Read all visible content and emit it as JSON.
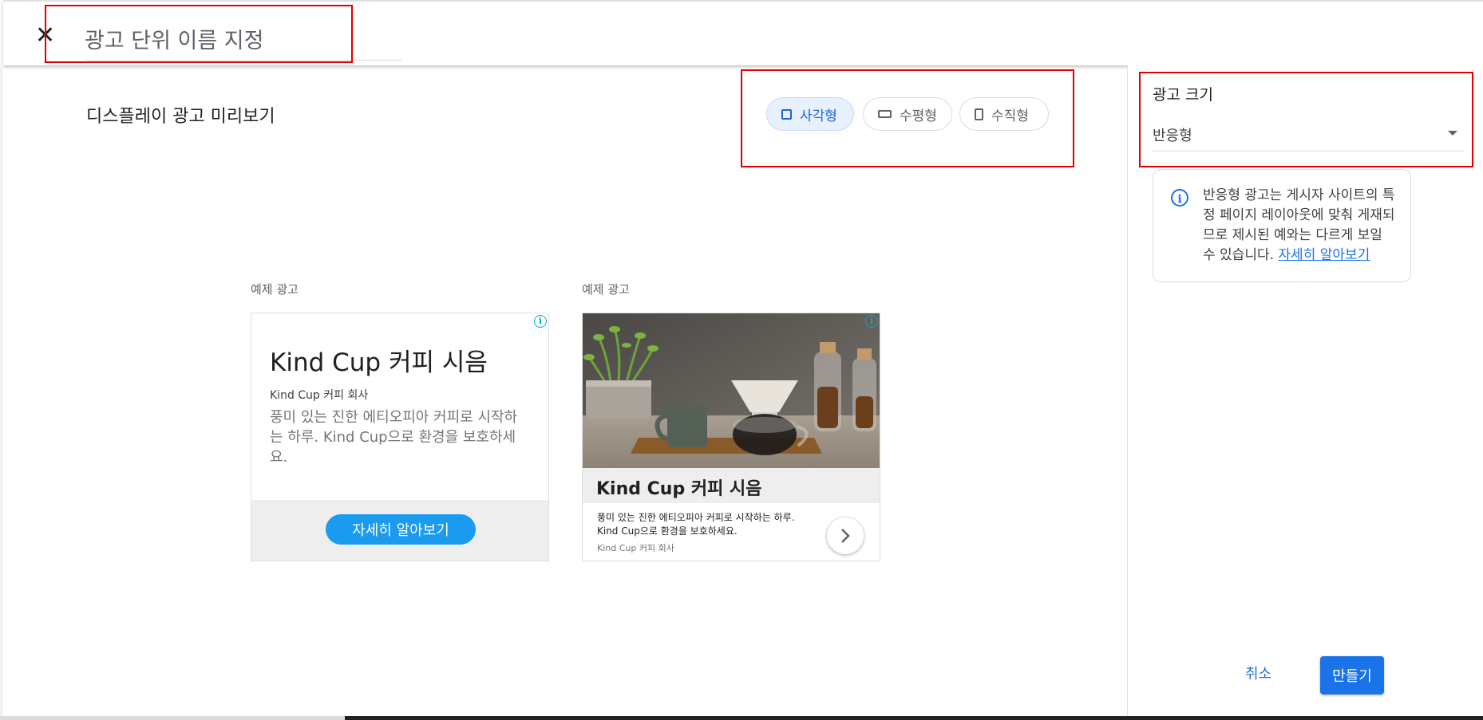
{
  "header": {
    "close_icon": "close-icon",
    "name_placeholder": "광고 단위 이름 지정"
  },
  "preview": {
    "title": "디스플레이 광고 미리보기",
    "shapes": [
      {
        "label": "사각형",
        "icon": "square-icon",
        "selected": true
      },
      {
        "label": "수평형",
        "icon": "horizontal-rect-icon",
        "selected": false
      },
      {
        "label": "수직형",
        "icon": "vertical-rect-icon",
        "selected": false
      }
    ]
  },
  "sidebar": {
    "size_label": "광고 크기",
    "size_value": "반응형",
    "info_text": "반응형 광고는 게시자 사이트의 특정 페이지 레이아웃에 맞춰 게재되므로 제시된 예와는 다르게 보일 수 있습니다.",
    "info_link": "자세히 알아보기",
    "cancel_label": "취소",
    "create_label": "만들기"
  },
  "ads": [
    {
      "label": "예제 광고",
      "headline": "Kind Cup 커피 시음",
      "business": "Kind Cup 커피 회사",
      "description": "풍미 있는 진한 에티오피아 커피로 시작하는 하루. Kind Cup으로 환경을 보호하세요.",
      "cta": "자세히 알아보기"
    },
    {
      "label": "예제 광고",
      "headline": "Kind Cup 커피 시음",
      "business": "Kind Cup 커피 회사",
      "description": "풍미 있는 진한 에티오피아 커피로 시작하는 하루. Kind Cup으로 환경을 보호하세요."
    }
  ],
  "colors": {
    "accent": "#1a73e8",
    "cta": "#1a9bf0",
    "highlight": "#e00000"
  }
}
